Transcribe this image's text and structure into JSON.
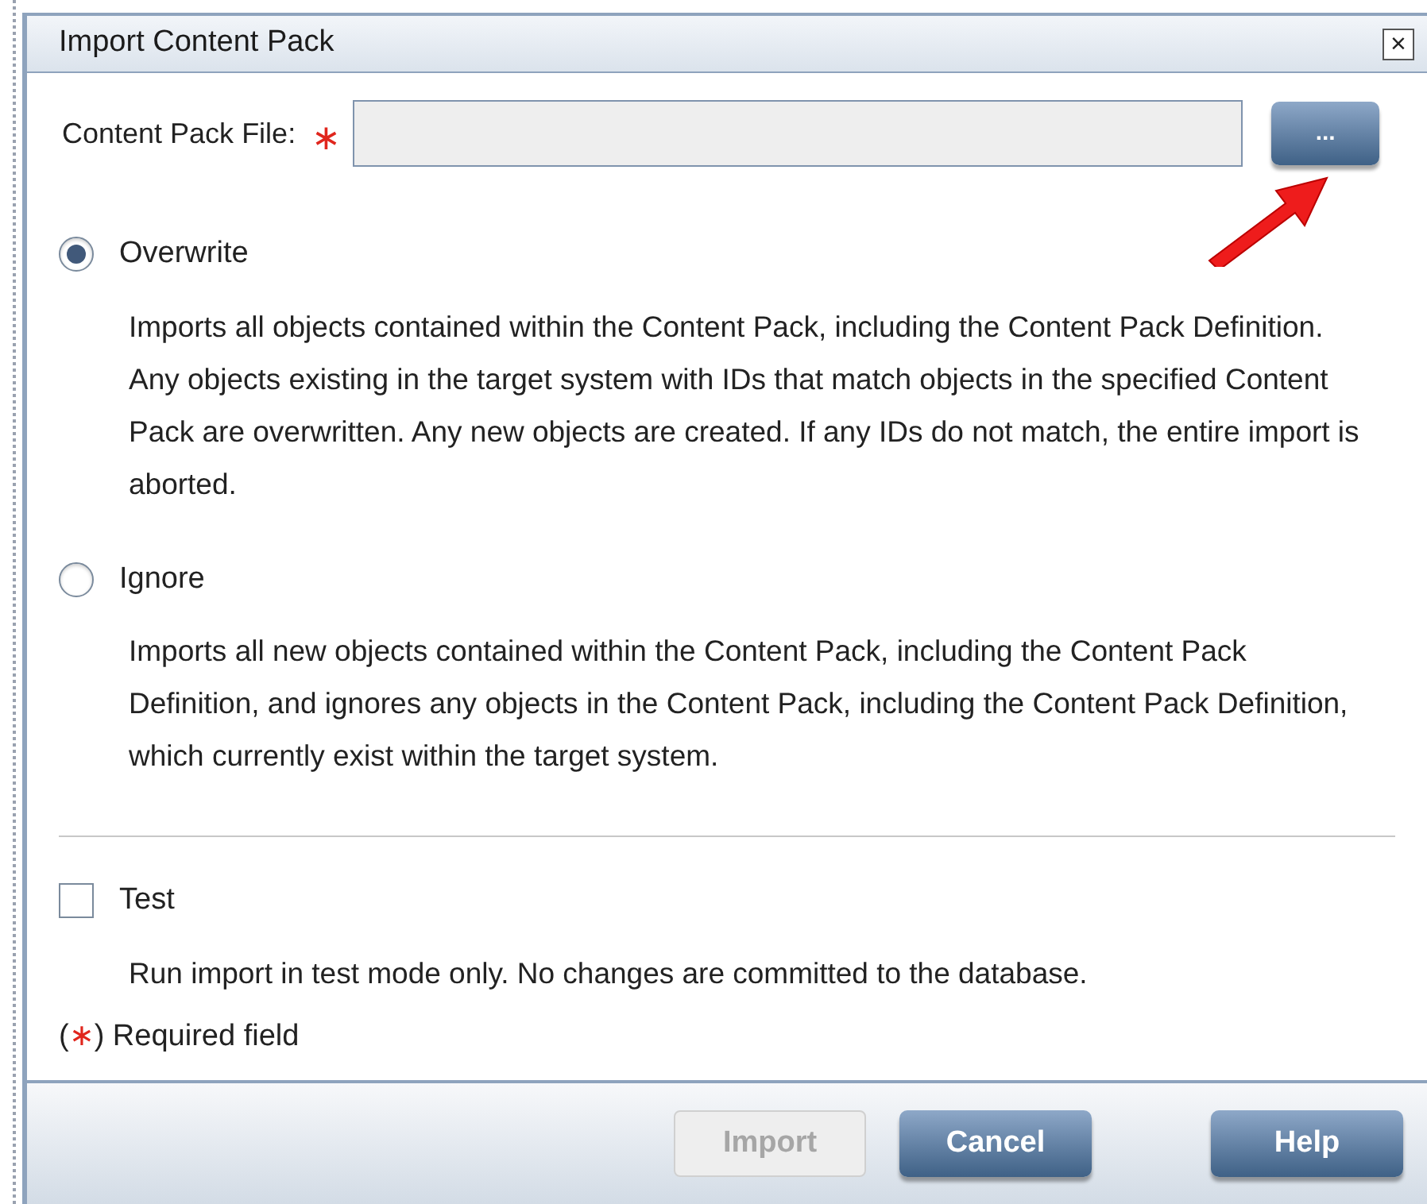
{
  "dialog": {
    "title": "Import Content Pack",
    "close": "×"
  },
  "file_field": {
    "label": "Content Pack File:",
    "required_mark": "∗",
    "browse": "..."
  },
  "options": [
    {
      "kind": "radio",
      "label": "Overwrite",
      "selected": true,
      "description": "Imports all objects contained within the Content Pack, including the Content Pack Definition. Any objects existing in the target system with IDs that match objects in the specified Content Pack are overwritten. Any new objects are created. If any IDs do not match, the entire import is aborted."
    },
    {
      "kind": "radio",
      "label": "Ignore",
      "selected": false,
      "description": "Imports all new objects contained within the Content Pack, including the Content Pack Definition, and ignores any objects in the Content Pack, including the Content Pack Definition, which currently exist within the target system."
    },
    {
      "kind": "checkbox",
      "label": "Test",
      "checked": false,
      "description": "Run import in test mode only. No changes are committed to the database."
    }
  ],
  "legend": {
    "before": "(",
    "mark": "∗",
    "after": ") Required field"
  },
  "buttons": [
    {
      "label": "Import",
      "disabled": true
    },
    {
      "label": "Cancel",
      "disabled": false
    },
    {
      "label": "Help",
      "disabled": false
    }
  ]
}
